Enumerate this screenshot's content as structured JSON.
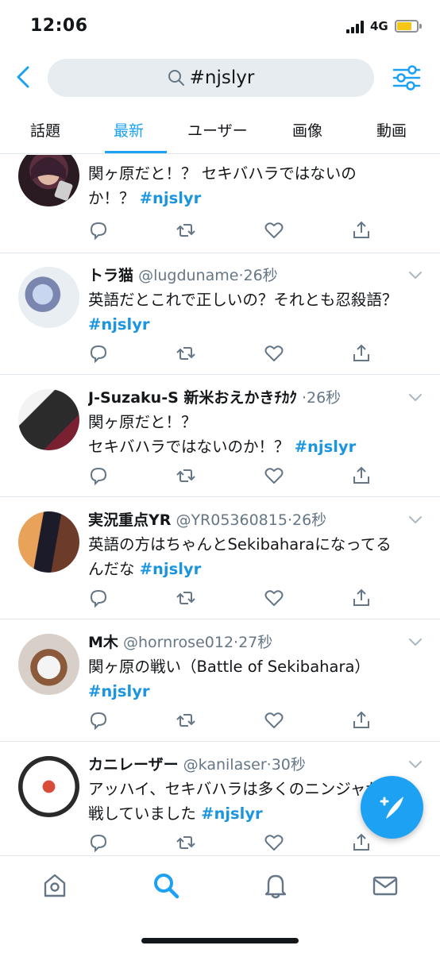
{
  "status": {
    "time": "12:06",
    "network": "4G",
    "colors": {
      "battery": "#f5c518"
    }
  },
  "search": {
    "query": "#njslyr"
  },
  "tabs": [
    {
      "label": "話題"
    },
    {
      "label": "最新",
      "active": true
    },
    {
      "label": "ユーザー"
    },
    {
      "label": "画像"
    },
    {
      "label": "動画"
    }
  ],
  "tweets": [
    {
      "name": "",
      "handle": "",
      "time": "",
      "text": "関ヶ原だと！？ セキバハラではないの",
      "text2": "か！？ ",
      "hashtag": "#njslyr"
    },
    {
      "name": "トラ猫",
      "handle": "@lugduname",
      "time": "26秒",
      "text": "英語だとこれで正しいの？それとも忍殺語？",
      "text2": "",
      "hashtag": "#njslyr"
    },
    {
      "name": "J-Suzaku-S 新米おえかきﾁｶｸ",
      "handle": "",
      "time": "26秒",
      "text": "関ヶ原だと！？",
      "text2": "セキバハラではないのか！？ ",
      "hashtag": "#njslyr"
    },
    {
      "name": "実況重点YR",
      "handle": "@YR05360815",
      "time": "26秒",
      "text": "英語の方はちゃんとSekibaharaになってる",
      "text2": "んだな ",
      "hashtag": "#njslyr"
    },
    {
      "name": "M木",
      "handle": "@hornrose012",
      "time": "27秒",
      "text": "関ヶ原の戦い（Battle of Sekibahara）",
      "text2": "",
      "hashtag": "#njslyr"
    },
    {
      "name": "カニレーザー",
      "handle": "@kanilaser",
      "time": "30秒",
      "text": "アッハイ、セキバハラは多くのニンジャが参",
      "text2": "戦していました ",
      "hashtag": "#njslyr"
    }
  ],
  "colors": {
    "accent": "#1da1f2",
    "hashtag": "#1b95e0",
    "text_secondary": "#657786"
  }
}
